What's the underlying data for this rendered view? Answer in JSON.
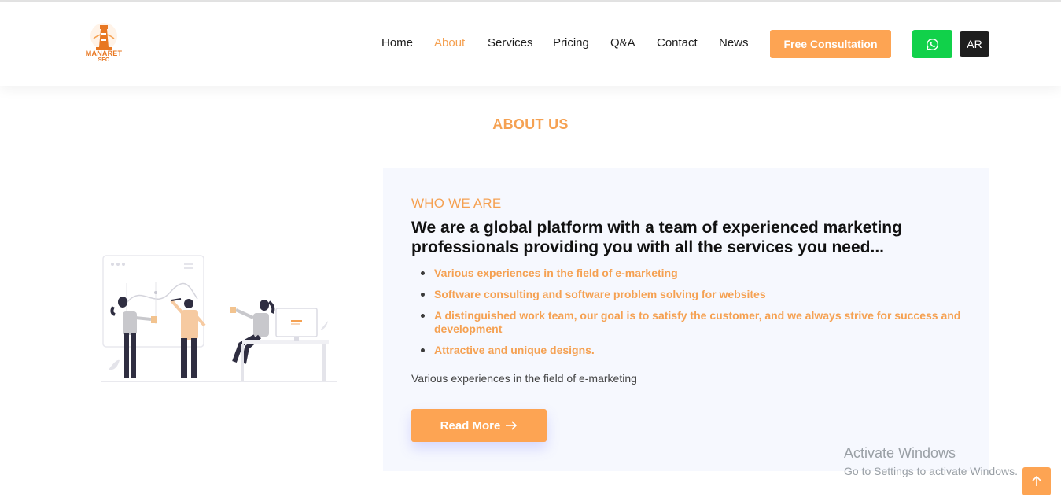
{
  "brand": {
    "logo_text": "MANARET",
    "logo_sub": "SEO"
  },
  "nav": {
    "items": [
      {
        "label": "Home"
      },
      {
        "label": "About"
      },
      {
        "label": "Services"
      },
      {
        "label": "Pricing"
      },
      {
        "label": "Q&A"
      },
      {
        "label": "Contact"
      },
      {
        "label": "News"
      }
    ],
    "active_index": 1,
    "consult_label": "Free Consultation",
    "whatsapp_icon": "whatsapp-icon",
    "lang_label": "AR"
  },
  "about": {
    "section_title": "ABOUT US",
    "who_label": "WHO WE ARE",
    "headline": "We are a global platform with a team of experienced marketing professionals providing you with all the services you need...",
    "features": [
      "Various experiences in the field of e-marketing",
      "Software consulting and software problem solving for websites",
      "A distinguished work team, our goal is to satisfy the customer, and we always strive for success and development",
      "Attractive and unique designs."
    ],
    "summary": "Various experiences in the field of e-marketing",
    "read_more_label": "Read More",
    "read_more_icon": "arrow-right-icon"
  },
  "watermark": {
    "title": "Activate Windows",
    "subtitle": "Go to Settings to activate Windows."
  },
  "colors": {
    "accent": "#fda453",
    "accent_text": "#f5a152",
    "whatsapp": "#11d14a",
    "dark": "#1e1e1e",
    "card_bg": "#f6f8fe"
  },
  "scroll_top_icon": "arrow-up-icon"
}
